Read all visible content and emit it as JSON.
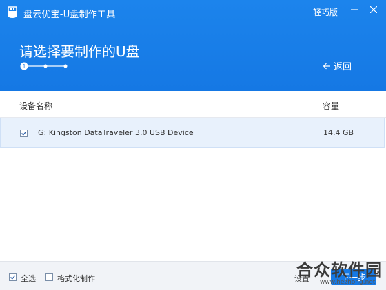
{
  "window": {
    "title": "盘云优宝-U盘制作工具",
    "edition": "轻巧版"
  },
  "page": {
    "heading": "请选择要制作的U盘",
    "current_step": 1,
    "back_label": "返回"
  },
  "table": {
    "columns": {
      "name": "设备名称",
      "capacity": "容量"
    },
    "rows": [
      {
        "checked": true,
        "device": "G: Kingston DataTraveler 3.0 USB Device",
        "capacity": "14.4 GB"
      }
    ]
  },
  "footer": {
    "select_all_label": "全选",
    "select_all_checked": true,
    "format_label": "格式化制作",
    "format_checked": false,
    "settings_label": "设置",
    "next_label": "下一步"
  },
  "watermark": {
    "text": "合众软件园",
    "url": "www.hezhong.net"
  },
  "colors": {
    "header_blue": "#1578e4",
    "row_selected": "#e8f1fc"
  }
}
